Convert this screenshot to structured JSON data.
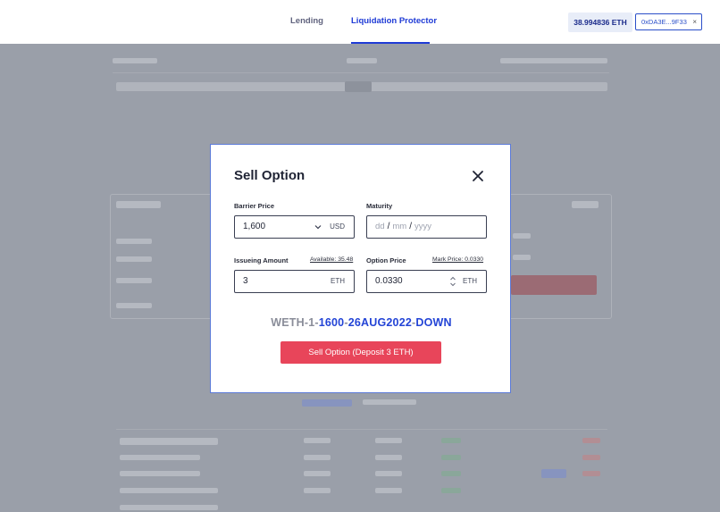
{
  "nav": {
    "tabs": [
      {
        "label": "Lending",
        "active": false
      },
      {
        "label": "Liquidation Protector",
        "active": true
      }
    ],
    "balance": "38.994836 ETH",
    "wallet": "0xDA3E...9F33",
    "wallet_close": "×"
  },
  "modal": {
    "title": "Sell Option",
    "barrier": {
      "label": "Barrier Price",
      "value": "1,600",
      "unit": "USD"
    },
    "maturity": {
      "label": "Maturity",
      "dd": "dd",
      "mm": "mm",
      "yyyy": "yyyy",
      "sep": "/"
    },
    "amount": {
      "label": "Issueing Amount",
      "available": "Available: 35.48",
      "value": "3",
      "unit": "ETH"
    },
    "option_price": {
      "label": "Option Price",
      "mark": "Mark Price: 0.0330",
      "value": "0.0330",
      "unit": "ETH"
    },
    "option_id": {
      "prefix": "WETH-1-",
      "strike": "1600",
      "dash1": "-",
      "date": "26AUG2022",
      "dash2": "-",
      "direction": "DOWN"
    },
    "submit_label": "Sell Option (Deposit 3 ETH)"
  },
  "colors": {
    "accent": "#1f3bd6",
    "danger": "#e8455a",
    "overlay": "#9a9fa9"
  }
}
